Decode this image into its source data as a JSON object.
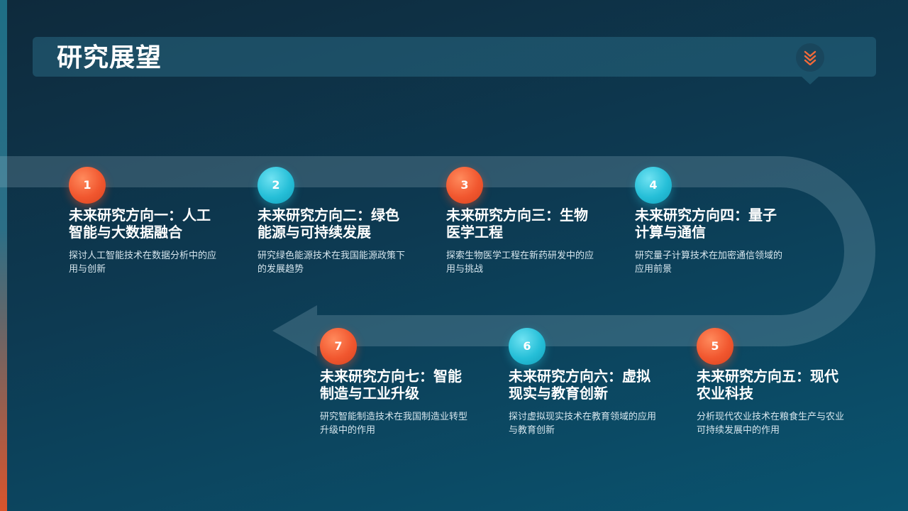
{
  "header": {
    "title": "研究展望",
    "icon": "double-chevron-down-icon"
  },
  "colors": {
    "orange_badge": "#f1572f",
    "cyan_badge": "#26bfd8",
    "background": "#0d3a52"
  },
  "steps": [
    {
      "number": "1",
      "title": "未来研究方向一：人工智能与大数据融合",
      "desc": "探讨人工智能技术在数据分析中的应用与创新"
    },
    {
      "number": "2",
      "title": "未来研究方向二：绿色能源与可持续发展",
      "desc": "研究绿色能源技术在我国能源政策下的发展趋势"
    },
    {
      "number": "3",
      "title": "未来研究方向三：生物医学工程",
      "desc": "探索生物医学工程在新药研发中的应用与挑战"
    },
    {
      "number": "4",
      "title": "未来研究方向四：量子计算与通信",
      "desc": "研究量子计算技术在加密通信领域的应用前景"
    },
    {
      "number": "5",
      "title": "未来研究方向五：现代农业科技",
      "desc": "分析现代农业技术在粮食生产与农业可持续发展中的作用"
    },
    {
      "number": "6",
      "title": "未来研究方向六：虚拟现实与教育创新",
      "desc": "探讨虚拟现实技术在教育领域的应用与教育创新"
    },
    {
      "number": "7",
      "title": "未来研究方向七：智能制造与工业升级",
      "desc": "研究智能制造技术在我国制造业转型升级中的作用"
    }
  ]
}
